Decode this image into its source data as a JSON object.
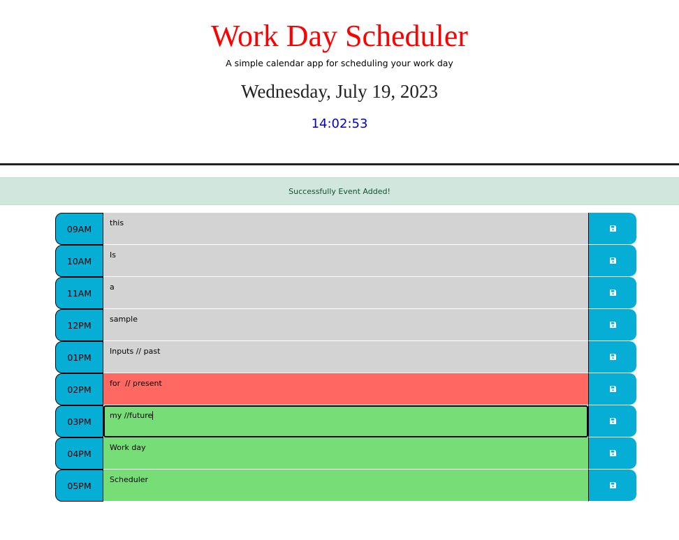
{
  "header": {
    "title": "Work Day Scheduler",
    "subtitle": "A simple calendar app for scheduling your work day",
    "date": "Wednesday, July 19, 2023",
    "time": "14:02:53"
  },
  "alert": {
    "message": "Successfully Event Added!"
  },
  "colors": {
    "title": "#ff0000",
    "time": "#0000cc",
    "hour_block": "#06aed5",
    "past": "#d3d3d3",
    "present": "#ff6961",
    "future": "#77dd77",
    "alert_bg": "#d1e7dd"
  },
  "save_icon": "floppy-disk-icon",
  "rows": [
    {
      "hour": "09AM",
      "text": "this",
      "state": "past"
    },
    {
      "hour": "10AM",
      "text": "Is",
      "state": "past"
    },
    {
      "hour": "11AM",
      "text": "a",
      "state": "past"
    },
    {
      "hour": "12PM",
      "text": "sample",
      "state": "past"
    },
    {
      "hour": "01PM",
      "text": "Inputs // past",
      "state": "past"
    },
    {
      "hour": "02PM",
      "text": "for  // present",
      "state": "present"
    },
    {
      "hour": "03PM",
      "text": "my //future",
      "state": "future"
    },
    {
      "hour": "04PM",
      "text": "Work day",
      "state": "future"
    },
    {
      "hour": "05PM",
      "text": "Scheduler",
      "state": "future"
    }
  ]
}
